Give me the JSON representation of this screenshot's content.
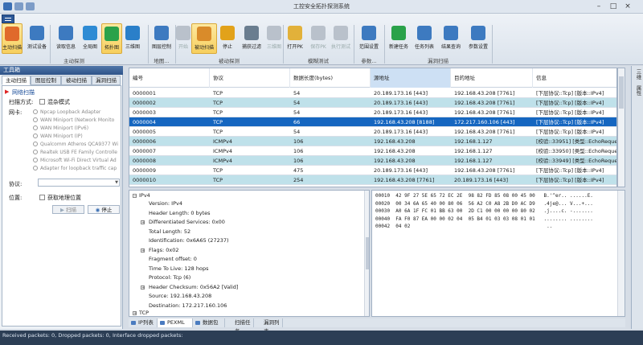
{
  "window": {
    "title": "工控安全拓扑探测系统"
  },
  "ribbon": {
    "buttons": [
      {
        "label": "主动扫描",
        "icon": "active-scan-icon",
        "active": true
      },
      {
        "label": "测试设备",
        "icon": "test-device-icon"
      },
      {
        "label": "读取信息",
        "icon": "read-info-icon"
      },
      {
        "label": "全局图",
        "icon": "global-map-icon"
      },
      {
        "label": "拓扑图",
        "icon": "topology-icon",
        "active": true
      },
      {
        "label": "三维图",
        "icon": "3d-view-icon"
      },
      {
        "label": "图层控制",
        "icon": "layer-control-icon"
      },
      {
        "label": "开始",
        "icon": "start-icon",
        "disabled": true
      },
      {
        "label": "被动扫描",
        "icon": "passive-scan-icon",
        "active": true
      },
      {
        "label": "停止",
        "icon": "stop-icon"
      },
      {
        "label": "捕获过滤",
        "icon": "capture-filter-icon"
      },
      {
        "label": "三维图",
        "icon": "3d-view-2-icon",
        "disabled": true
      },
      {
        "label": "打开PK",
        "icon": "open-pk-icon"
      },
      {
        "label": "保存PK",
        "icon": "save-pk-icon",
        "disabled": true
      },
      {
        "label": "执行测试",
        "icon": "run-test-icon",
        "disabled": true
      },
      {
        "label": "范围设置",
        "icon": "range-settings-icon"
      },
      {
        "label": "新建任务",
        "icon": "new-task-icon"
      },
      {
        "label": "任务列表",
        "icon": "task-list-icon"
      },
      {
        "label": "结果查询",
        "icon": "result-query-icon"
      },
      {
        "label": "参数设置",
        "icon": "param-settings-icon"
      }
    ],
    "groups": [
      "主动探测",
      "地图...",
      "被动探测",
      "模糊测试",
      "参数...",
      "漏洞扫描"
    ]
  },
  "leftpanel": {
    "title": "工具箱",
    "tabs": [
      "主动扫描",
      "图层控制",
      "被动扫描",
      "漏洞扫描"
    ],
    "section": "网络扫描",
    "scan_mode_label": "扫描方式:",
    "scan_mode_value": "混杂模式",
    "nic_label": "网卡:",
    "nics": [
      "Npcap Loopback Adapter",
      "WAN Miniport (Network Monito",
      "WAN Miniport (IPv6)",
      "WAN Miniport (IP)",
      "Qualcomm Atheros QCA9377 Wi",
      "Realtek USB FE Family Controlle",
      "Microsoft Wi-Fi Direct Virtual Ad",
      "Adapter for loopback traffic cap"
    ],
    "protocol_label": "协议:",
    "position_label": "位置:",
    "get_geo_label": "获取地理位置",
    "scan_button": "扫描",
    "stop_button": "停止"
  },
  "rightstrip": {
    "tabs": [
      "三维",
      "属性"
    ]
  },
  "packets": {
    "headers": [
      "编号",
      "协议",
      "数据长度(bytes)",
      "源地址",
      "目的地址",
      "信息"
    ],
    "rows": [
      [
        "0000001",
        "TCP",
        "54",
        "20.189.173.16 [443]",
        "192.168.43.208 [7761]",
        "[下层协议::Tcp] [版本::IPv4]"
      ],
      [
        "0000002",
        "TCP",
        "54",
        "20.189.173.16 [443]",
        "192.168.43.208 [7761]",
        "[下层协议::Tcp] [版本::IPv4]"
      ],
      [
        "0000003",
        "TCP",
        "54",
        "20.189.173.16 [443]",
        "192.168.43.208 [7761]",
        "[下层协议::Tcp] [版本::IPv4]"
      ],
      [
        "0000004",
        "TCP",
        "66",
        "192.168.43.208 [8188]",
        "172.217.160.106 [443]",
        "[下层协议::Tcp] [版本::IPv4]"
      ],
      [
        "0000005",
        "TCP",
        "54",
        "20.189.173.16 [443]",
        "192.168.43.208 [7761]",
        "[下层协议::Tcp] [版本::IPv4]"
      ],
      [
        "0000006",
        "ICMPv4",
        "106",
        "192.168.43.208",
        "192.168.1.127",
        "[校验::33951] [类型::EchoReque..."
      ],
      [
        "0000007",
        "ICMPv4",
        "106",
        "192.168.43.208",
        "192.168.1.127",
        "[校验::33950] [类型::EchoReque..."
      ],
      [
        "0000008",
        "ICMPv4",
        "106",
        "192.168.43.208",
        "192.168.1.127",
        "[校验::33949] [类型::EchoReque..."
      ],
      [
        "0000009",
        "TCP",
        "475",
        "20.189.173.16 [443]",
        "192.168.43.208 [7761]",
        "[下层协议::Tcp] [版本::IPv4]"
      ],
      [
        "0000010",
        "TCP",
        "254",
        "192.168.43.208 [7761]",
        "20.189.173.16 [443]",
        "[下层协议::Tcp] [版本::IPv4]"
      ]
    ],
    "selected_index": 3
  },
  "tree": {
    "root": "IPv4",
    "items": [
      {
        "text": "Version: IPv4",
        "expand": false
      },
      {
        "text": "Header Length: 0 bytes",
        "expand": false
      },
      {
        "text": "Differentiated Services: 0x00",
        "expand": true
      },
      {
        "text": "Total Length: 52",
        "expand": false
      },
      {
        "text": "Identification: 0x6A65 (27237)",
        "expand": false
      },
      {
        "text": "Flags: 0x02",
        "expand": true
      },
      {
        "text": "Fragment offset: 0",
        "expand": false
      },
      {
        "text": "Time To Live: 128 hops",
        "expand": false
      },
      {
        "text": "Protocol: Tcp (6)",
        "expand": false
      },
      {
        "text": "Header Checksum: 0x56A2 [Valid]",
        "expand": true
      },
      {
        "text": "Source: 192.168.43.208",
        "expand": false
      },
      {
        "text": "Destination: 172.217.160.106",
        "expand": false
      }
    ],
    "next_root": "TCP"
  },
  "hex": {
    "lines": [
      "00010  42 9F 27 5E 65 72 EC 2E  98 82 FD 85 08 00 45 00   B.'^er.. ......E.",
      "00020  00 34 6A 65 40 00 80 06  56 A2 C0 A8 2B D0 AC D9   .4je@... V...+...",
      "00030  A0 6A 1F FC 01 BB 63 00  2D C1 00 00 00 00 80 02   .j....c. -.......",
      "00040  FA F0 87 EA 00 00 02 04  05 B4 01 03 03 08 01 01   ........ ........",
      "00042  04 02                                               .."
    ]
  },
  "bottom_tabs": [
    "IP列表",
    "PEXML",
    "数据包",
    "扫描任务",
    "漏洞列表"
  ],
  "status": "Received packets: 0, Dropped packets: 0, Interface dropped packets:"
}
